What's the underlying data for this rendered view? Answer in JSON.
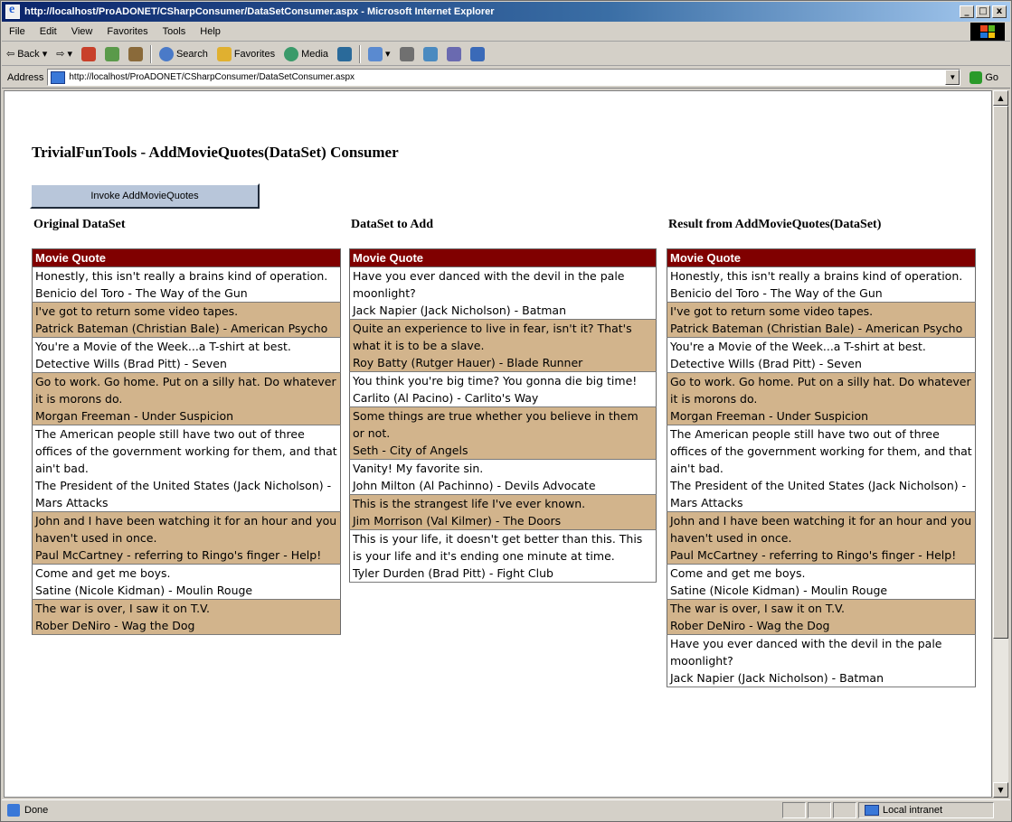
{
  "window": {
    "title": "http://localhost/ProADONET/CSharpConsumer/DataSetConsumer.aspx - Microsoft Internet Explorer",
    "min": "_",
    "max": "□",
    "close": "x"
  },
  "menubar": {
    "items": [
      "File",
      "Edit",
      "View",
      "Favorites",
      "Tools",
      "Help"
    ]
  },
  "toolbar": {
    "back": "Back",
    "forward": "",
    "search": "Search",
    "favorites": "Favorites",
    "media": "Media"
  },
  "address": {
    "label": "Address",
    "url": "http://localhost/ProADONET/CSharpConsumer/DataSetConsumer.aspx",
    "go": "Go"
  },
  "statusbar": {
    "text": "Done",
    "zone": "Local intranet"
  },
  "page": {
    "title": "TrivialFunTools - AddMovieQuotes(DataSet) Consumer",
    "invoke_button": "Invoke AddMovieQuotes",
    "header": "Movie Quote"
  },
  "columns": [
    {
      "heading": "Original DataSet",
      "quotes": [
        "Honestly, this isn't really a brains kind of operation.\nBenicio del Toro - The Way of the Gun",
        "I've got to return some video tapes.\nPatrick Bateman (Christian Bale) - American Psycho",
        "You're a Movie of the Week...a T-shirt at best.\nDetective Wills (Brad Pitt) - Seven",
        "Go to work. Go home. Put on a silly hat. Do whatever it is morons do.\nMorgan Freeman - Under Suspicion",
        "The American people still have two out of three offices of the government working for them, and that ain't bad.\nThe President of the United States (Jack Nicholson) - Mars Attacks",
        "John and I have been watching it for an hour and you haven't used in once.\nPaul McCartney - referring to Ringo's finger - Help!",
        "Come and get me boys.\nSatine (Nicole Kidman) - Moulin Rouge",
        "The war is over, I saw it on T.V.\nRober DeNiro - Wag the Dog"
      ]
    },
    {
      "heading": "DataSet to Add",
      "quotes": [
        "Have you ever danced with the devil in the pale moonlight?\nJack Napier (Jack Nicholson) - Batman",
        "Quite an experience to live in fear, isn't it? That's what it is to be a slave.\nRoy Batty (Rutger Hauer) - Blade Runner",
        "You think you're big time? You gonna die big time!\nCarlito (Al Pacino) - Carlito's Way",
        "Some things are true whether you believe in them or not.\nSeth - City of Angels",
        "Vanity! My favorite sin.\nJohn Milton (Al Pachinno) - Devils Advocate",
        "This is the strangest life I've ever known.\nJim Morrison (Val Kilmer) - The Doors",
        "This is your life, it doesn't get better than this. This is your life and it's ending one minute at time.\nTyler Durden (Brad Pitt) - Fight Club"
      ]
    },
    {
      "heading": "Result from AddMovieQuotes(DataSet)",
      "quotes": [
        "Honestly, this isn't really a brains kind of operation.\nBenicio del Toro - The Way of the Gun",
        "I've got to return some video tapes.\nPatrick Bateman (Christian Bale) - American Psycho",
        "You're a Movie of the Week...a T-shirt at best.\nDetective Wills (Brad Pitt) - Seven",
        "Go to work. Go home. Put on a silly hat. Do whatever it is morons do.\nMorgan Freeman - Under Suspicion",
        "The American people still have two out of three offices of the government working for them, and that ain't bad.\nThe President of the United States (Jack Nicholson) - Mars Attacks",
        "John and I have been watching it for an hour and you haven't used in once.\nPaul McCartney - referring to Ringo's finger - Help!",
        "Come and get me boys.\nSatine (Nicole Kidman) - Moulin Rouge",
        "The war is over, I saw it on T.V.\nRober DeNiro - Wag the Dog",
        "Have you ever danced with the devil in the pale moonlight?\nJack Napier (Jack Nicholson) - Batman"
      ]
    }
  ],
  "colors": {
    "header_bg": "#800000",
    "alt_row_bg": "#d2b48c",
    "button_bg": "#b8c6da"
  }
}
